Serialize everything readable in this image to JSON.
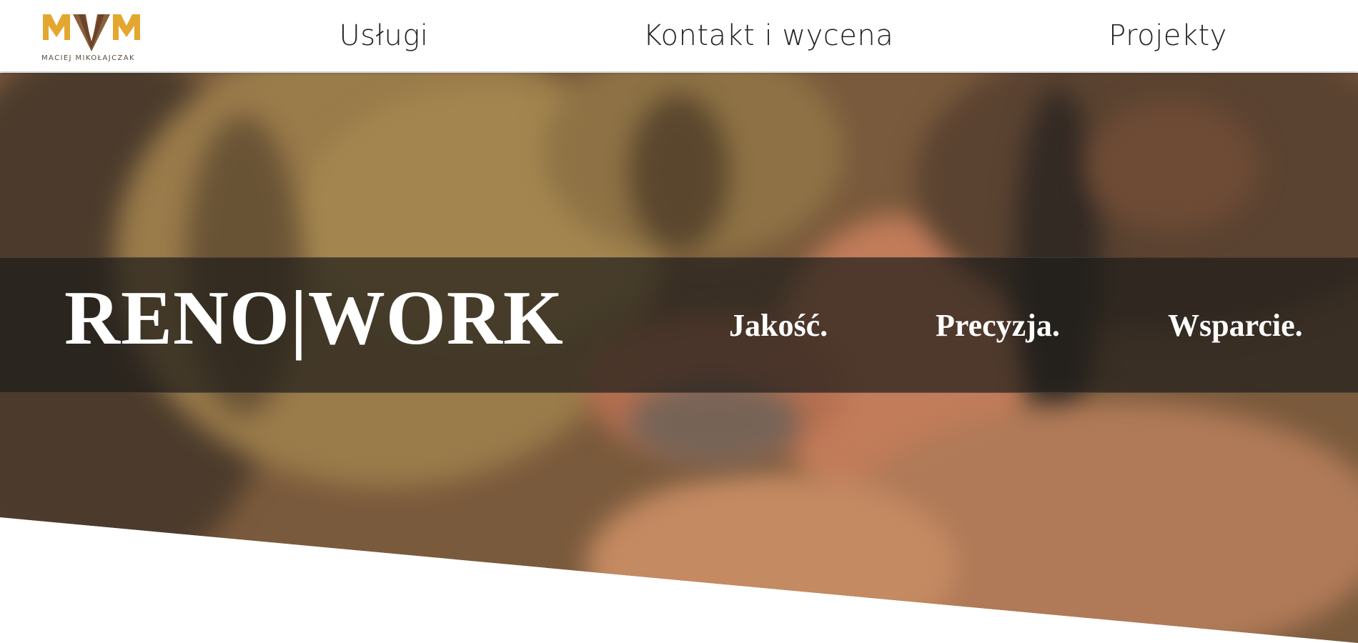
{
  "header": {
    "logo": {
      "letters": "MVM",
      "caption": "MACIEJ MIKOŁAJCZAK",
      "color": "#e3a72f"
    },
    "nav": [
      {
        "label": "Usługi"
      },
      {
        "label": "Kontakt i wycena"
      },
      {
        "label": "Projekty"
      }
    ]
  },
  "hero": {
    "brand": "RENO|WORK",
    "taglines": [
      "Jakość.",
      "Precyzja.",
      "Wsparcie."
    ]
  }
}
